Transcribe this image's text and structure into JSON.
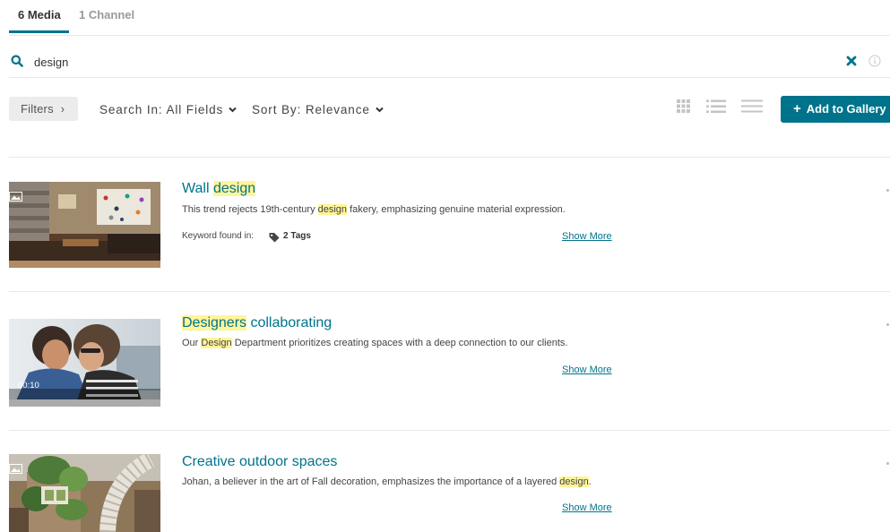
{
  "tabs": [
    {
      "label": "6 Media"
    },
    {
      "label": "1 Channel"
    }
  ],
  "search": {
    "value": "design",
    "clear_icon": "close-icon",
    "info_icon": "info-icon"
  },
  "toolbar": {
    "filters_label": "Filters",
    "search_in_label": "Search In: All Fields",
    "sort_by_label": "Sort By: Relevance",
    "add_to_gallery_label": "Add to Gallery",
    "views": [
      "grid-view-icon",
      "detailed-list-view-icon",
      "compact-list-view-icon"
    ]
  },
  "colors": {
    "accent": "#00738c",
    "highlight": "#fff59a"
  },
  "results": [
    {
      "title_parts": [
        "Wall ",
        "design"
      ],
      "desc_parts": [
        "This trend rejects 19th-century ",
        "design",
        " fakery, emphasizing genuine material expression."
      ],
      "keyword_label": "Keyword found in:",
      "tags_label": "2 Tags",
      "show_more": "Show More"
    },
    {
      "title_parts": [
        "Designers",
        " collaborating"
      ],
      "desc_parts": [
        "Our ",
        "Design",
        " Department prioritizes creating spaces with a deep connection to our clients."
      ],
      "duration": "00:10",
      "show_more": "Show More"
    },
    {
      "title": "Creative outdoor spaces",
      "desc_parts": [
        "Johan, a believer in the art of Fall decoration, emphasizes the importance of a layered ",
        "design",
        "."
      ],
      "show_more": "Show More"
    }
  ]
}
